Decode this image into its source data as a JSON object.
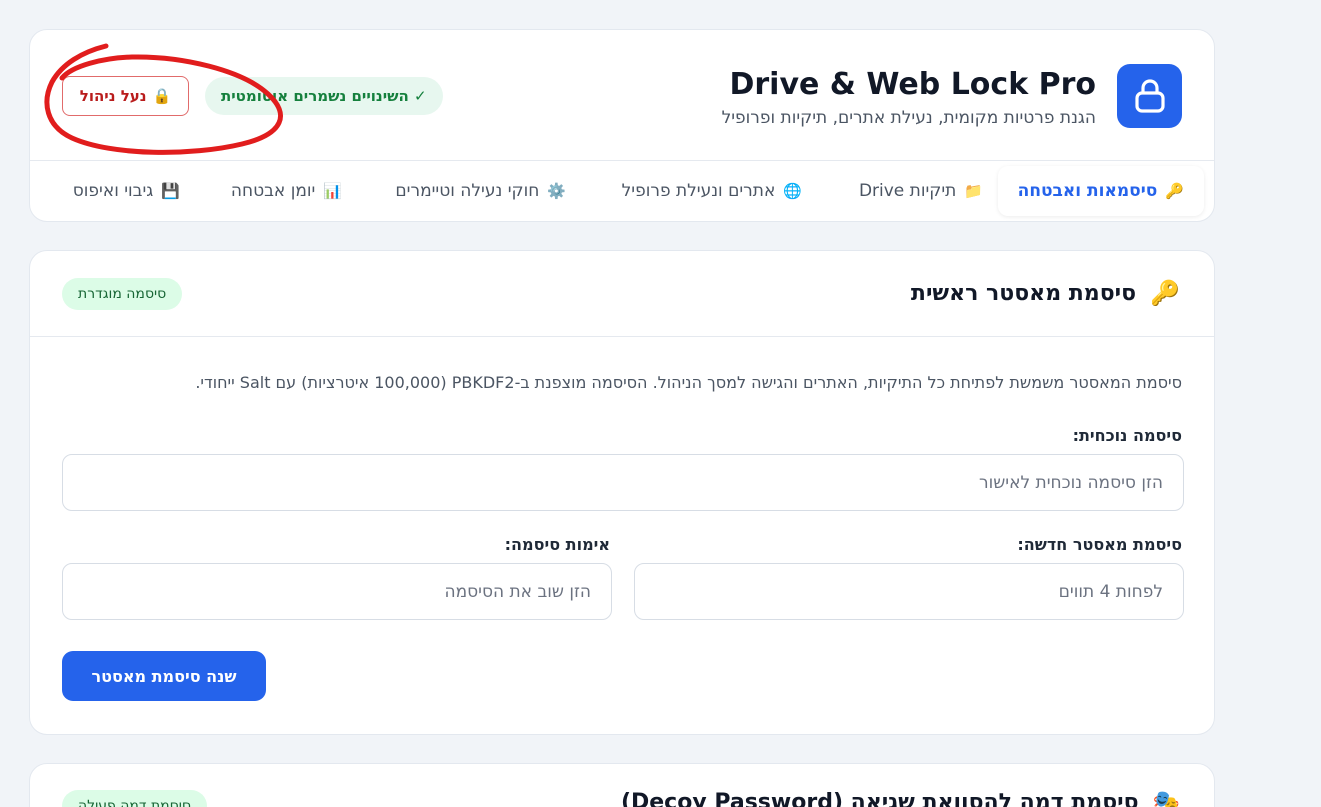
{
  "app": {
    "title": "Drive & Web Lock Pro",
    "subtitle": "הגנת פרטיות מקומית, נעילת אתרים, תיקיות ופרופיל",
    "saved_status": "✓ השינויים נשמרים אוטומטית",
    "lock_admin_label": "נעל ניהול",
    "accent_color": "#2563eb",
    "danger_color": "#b91c1c"
  },
  "tabs": [
    {
      "label": "סיסמאות ואבטחה",
      "icon": "🔑",
      "icon_name": "key-icon",
      "active": true
    },
    {
      "label": "תיקיות Drive",
      "icon": "📁",
      "icon_name": "folder-icon",
      "active": false
    },
    {
      "label": "אתרים ונעילת פרופיל",
      "icon": "🌐",
      "icon_name": "globe-icon",
      "active": false
    },
    {
      "label": "חוקי נעילה וטיימרים",
      "icon": "⚙️",
      "icon_name": "gear-icon",
      "active": false
    },
    {
      "label": "יומן אבטחה",
      "icon": "📊",
      "icon_name": "chart-icon",
      "active": false
    },
    {
      "label": "גיבוי ואיפוס",
      "icon": "💾",
      "icon_name": "floppy-disk-icon",
      "active": false
    }
  ],
  "master_section": {
    "title": "סיסמת מאסטר ראשית",
    "icon": "🔑",
    "status": "סיסמה מוגדרת",
    "description": "סיסמת המאסטר משמשת לפתיחת כל התיקיות, האתרים והגישה למסך הניהול. הסיסמה מוצפנת ב-PBKDF2 (100,000 איטרציות) עם Salt ייחודי.",
    "current_label": "סיסמה נוכחית:",
    "current_placeholder": "הזן סיסמה נוכחית לאישור",
    "current_value": "",
    "new_label": "סיסמת מאסטר חדשה:",
    "new_placeholder": "לפחות 4 תווים",
    "new_value": "",
    "confirm_label": "אימות סיסמה:",
    "confirm_placeholder": "הזן שוב את הסיסמה",
    "confirm_value": "",
    "submit_label": "שנה סיסמת מאסטר"
  },
  "decoy_section": {
    "title": "סיסמת דמה להסוואת שגיאה (Decoy Password)",
    "icon": "🎭",
    "status": "סיסמת דמה פעילה"
  }
}
